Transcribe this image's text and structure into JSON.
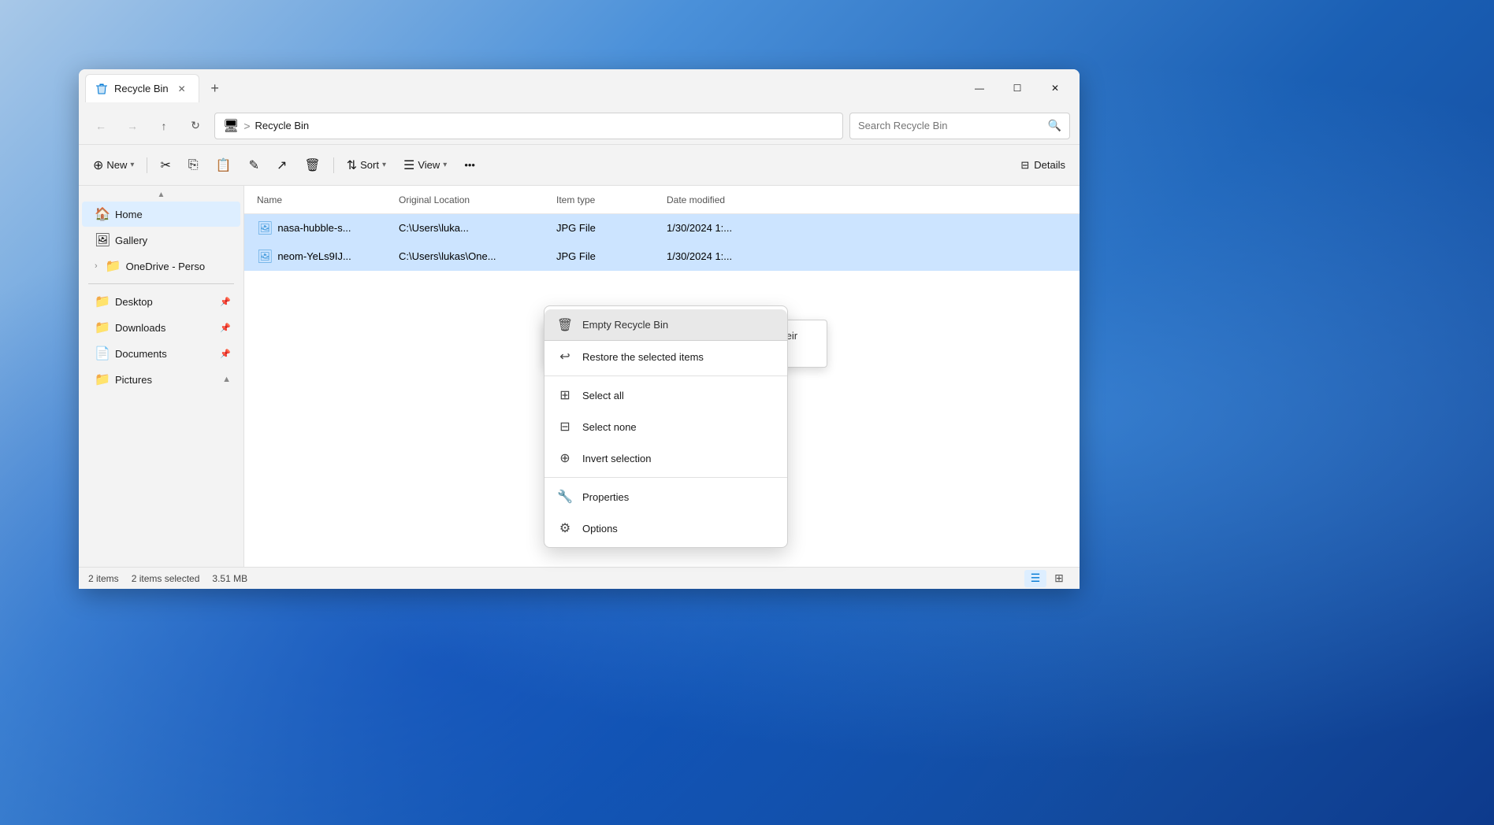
{
  "window": {
    "title": "Recycle Bin",
    "tab_label": "Recycle Bin"
  },
  "tabs": [
    {
      "label": "Recycle Bin",
      "active": true
    }
  ],
  "address": {
    "path_icon": "🖥",
    "separator": ">",
    "current": "Recycle Bin"
  },
  "search": {
    "placeholder": "Search Recycle Bin"
  },
  "toolbar": {
    "new_label": "New",
    "sort_label": "Sort",
    "view_label": "View",
    "details_label": "Details"
  },
  "sidebar": {
    "items": [
      {
        "id": "home",
        "icon": "🏠",
        "label": "Home",
        "active": true
      },
      {
        "id": "gallery",
        "icon": "🖼",
        "label": "Gallery",
        "active": false
      },
      {
        "id": "onedrive",
        "icon": "📁",
        "label": "OneDrive - Perso",
        "expand": true,
        "active": false
      },
      {
        "id": "desktop",
        "icon": "📁",
        "label": "Desktop",
        "pin": true,
        "active": false
      },
      {
        "id": "downloads",
        "icon": "📁",
        "label": "Downloads",
        "pin": true,
        "active": false
      },
      {
        "id": "documents",
        "icon": "📄",
        "label": "Documents",
        "pin": true,
        "active": false
      },
      {
        "id": "pictures",
        "icon": "📁",
        "label": "Pictures",
        "expand": false,
        "active": false
      }
    ]
  },
  "columns": {
    "name": "Name",
    "location": "Original Location",
    "type": "Item type",
    "date": "Date modified"
  },
  "files": [
    {
      "name": "nasa-hubble-s...",
      "location": "C:\\Users\\luka...",
      "type": "JPG File",
      "date": "1/30/2024 1:..."
    },
    {
      "name": "neom-YeLs9IJ...",
      "location": "C:\\Users\\lukas\\One...",
      "type": "JPG File",
      "date": "1/30/2024 1:..."
    }
  ],
  "status": {
    "item_count": "2 items",
    "selected": "2 items selected",
    "size": "3.51 MB"
  },
  "context_menu": {
    "header": "Empty Recycle Bin",
    "tooltip": "Move the selected items from the Recycle Bin to their original locations on your computer.",
    "items": [
      {
        "id": "restore",
        "icon": "↩",
        "label": "Restore the selected items"
      },
      {
        "id": "select-all",
        "icon": "⊞",
        "label": "Select all"
      },
      {
        "id": "select-none",
        "icon": "⊟",
        "label": "Select none"
      },
      {
        "id": "invert",
        "icon": "⊕",
        "label": "Invert selection"
      },
      {
        "id": "properties",
        "icon": "🔧",
        "label": "Properties"
      },
      {
        "id": "options",
        "icon": "⚙",
        "label": "Options"
      }
    ]
  }
}
